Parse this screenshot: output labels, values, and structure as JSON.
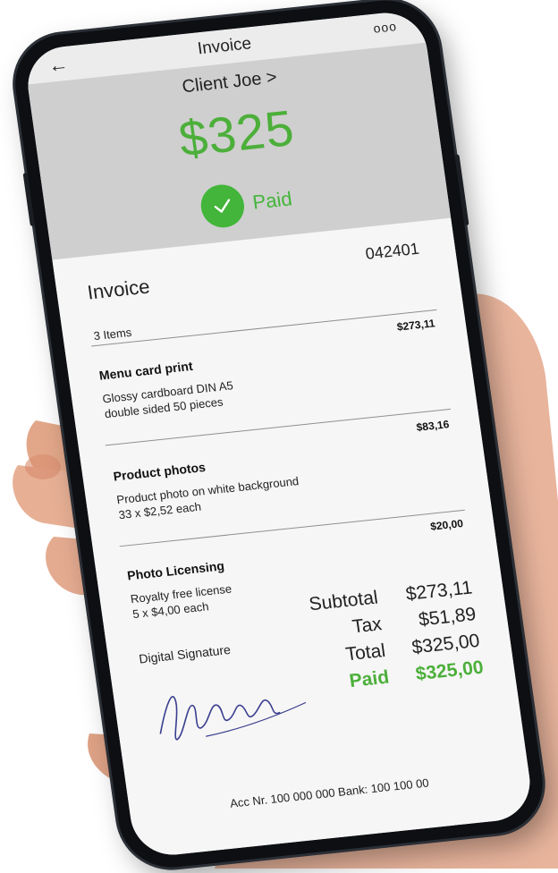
{
  "topbar": {
    "title": "Invoice",
    "back_icon": "arrow-left-icon",
    "more_icon": "more-dots-icon",
    "more_glyph": "ooo"
  },
  "header": {
    "client_link": "Client Joe >",
    "amount": "$325",
    "status": "Paid",
    "status_icon": "check-circle-icon"
  },
  "invoice": {
    "title": "Invoice",
    "number": "042401",
    "items_count": "3 Items",
    "items": [
      {
        "name": "Menu card print",
        "desc_line1": "Glossy cardboard DIN A5",
        "desc_line2": "double sided 50 pieces",
        "price": "$273,11"
      },
      {
        "name": "Product photos",
        "desc_line1": "Product photo on white background",
        "desc_line2": "33 x $2,52 each",
        "price": "$83,16"
      },
      {
        "name": "Photo Licensing",
        "desc_line1": "Royalty free license",
        "desc_line2": "5 x $4,00 each",
        "price": "$20,00"
      }
    ],
    "signature_label": "Digital Signature",
    "totals": {
      "subtotal_label": "Subtotal",
      "subtotal": "$273,11",
      "tax_label": "Tax",
      "tax": "$51,89",
      "total_label": "Total",
      "total": "$325,00",
      "paid_label": "Paid",
      "paid": "$325,00"
    },
    "footer": "Acc Nr. 100 000 000  Bank: 100 100 00"
  },
  "colors": {
    "accent_green": "#43b53a",
    "header_bg": "#cfcfcf",
    "phone_body": "#0d0f12"
  }
}
